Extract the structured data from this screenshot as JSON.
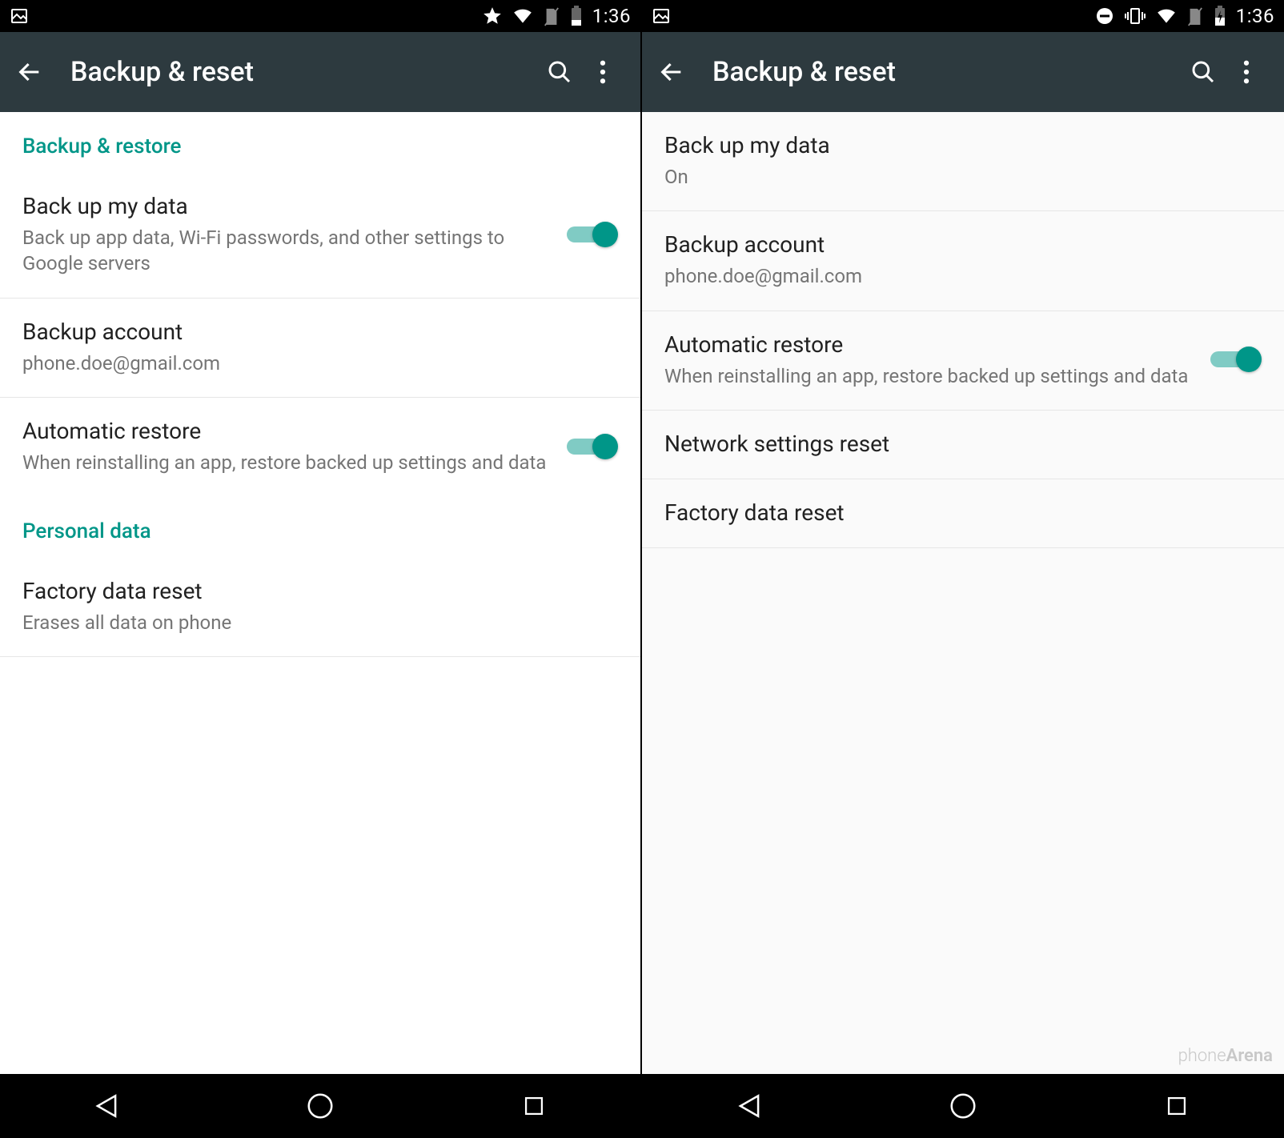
{
  "left": {
    "statusbar": {
      "time": "1:36"
    },
    "appbar": {
      "title": "Backup & reset"
    },
    "sections": [
      {
        "header": "Backup & restore",
        "rows": [
          {
            "title": "Back up my data",
            "subtitle": "Back up app data, Wi-Fi passwords, and other settings to Google servers",
            "toggle": true
          },
          {
            "title": "Backup account",
            "subtitle": "phone.doe@gmail.com"
          },
          {
            "title": "Automatic restore",
            "subtitle": "When reinstalling an app, restore backed up settings and data",
            "toggle": true
          }
        ]
      },
      {
        "header": "Personal data",
        "rows": [
          {
            "title": "Factory data reset",
            "subtitle": "Erases all data on phone"
          }
        ]
      }
    ]
  },
  "right": {
    "statusbar": {
      "time": "1:36"
    },
    "appbar": {
      "title": "Backup & reset"
    },
    "rows": [
      {
        "title": "Back up my data",
        "subtitle": "On"
      },
      {
        "title": "Backup account",
        "subtitle": "phone.doe@gmail.com"
      },
      {
        "title": "Automatic restore",
        "subtitle": "When reinstalling an app, restore backed up settings and data",
        "toggle": true
      },
      {
        "title": "Network settings reset"
      },
      {
        "title": "Factory data reset"
      }
    ],
    "watermark": {
      "a": "phone",
      "b": "Arena"
    }
  }
}
